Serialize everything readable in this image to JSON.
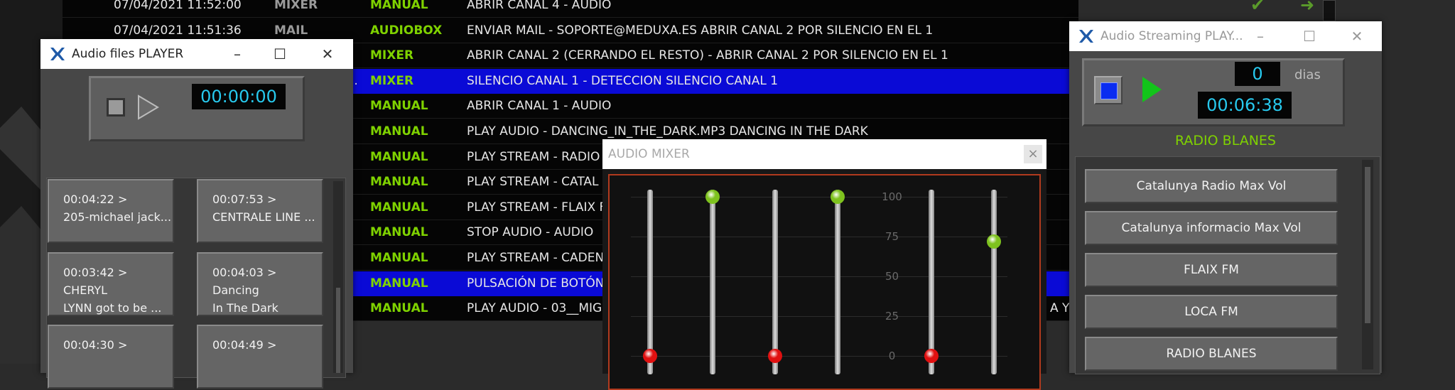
{
  "log": {
    "rows": [
      {
        "date": "07/04/2021 11:52:00",
        "origin": "MIXER",
        "type": "MANUAL",
        "desc": "ABRIR CANAL 4 -   AUDIO",
        "selected": false
      },
      {
        "date": "07/04/2021 11:51:36",
        "origin": "MAIL",
        "type": "AUDIOBOX",
        "desc": "ENVIAR MAIL - SOPORTE@MEDUXA.ES ABRIR CANAL 2 POR SILENCIO EN EL 1",
        "selected": false
      },
      {
        "date": "",
        "origin": "",
        "type": "MIXER",
        "desc": "ABRIR CANAL 2 (CERRANDO EL RESTO) -   ABRIR CANAL 2 POR SILENCIO EN EL 1",
        "selected": false
      },
      {
        "date": "",
        "origin": "",
        "type": "MIXER",
        "desc": "SILENCIO CANAL  1 -   DETECCION SILENCIO CANAL 1",
        "selected": true
      },
      {
        "date": "",
        "origin": "",
        "type": "MANUAL",
        "desc": "ABRIR CANAL 1 -   AUDIO",
        "selected": false
      },
      {
        "date": "",
        "origin": "",
        "type": "MANUAL",
        "desc": "PLAY AUDIO - DANCING_IN_THE_DARK.MP3 DANCING IN THE DARK",
        "selected": false
      },
      {
        "date": "",
        "origin": "",
        "type": "MANUAL",
        "desc": "PLAY STREAM -   RADIO",
        "selected": false
      },
      {
        "date": "",
        "origin": "",
        "type": "MANUAL",
        "desc": "PLAY STREAM -   CATAL",
        "selected": false
      },
      {
        "date": "",
        "origin": "",
        "type": "MANUAL",
        "desc": "PLAY STREAM -   FLAIX F",
        "selected": false
      },
      {
        "date": "",
        "origin": "",
        "type": "MANUAL",
        "desc": "STOP AUDIO -   AUDIO",
        "selected": false
      },
      {
        "date": "",
        "origin": "",
        "type": "MANUAL",
        "desc": "PLAY STREAM -   CADEN",
        "selected": false
      },
      {
        "date": "",
        "origin": "",
        "type": "MANUAL",
        "desc": "PULSACIÓN DE BOTÓN",
        "selected": true
      },
      {
        "date": "",
        "origin": "",
        "type": "MANUAL",
        "desc": "PLAY AUDIO - 03__MIG",
        "selected": false
      }
    ],
    "row3_prefix": "..",
    "row12_suffix": "A Y"
  },
  "player": {
    "title": "Audio files PLAYER",
    "time": "00:00:00",
    "files": [
      {
        "l1": "00:04:22 >",
        "l2": "205-michael jack..."
      },
      {
        "l1": "00:07:53 >",
        "l2": "CENTRALE LINE ..."
      },
      {
        "l1": "00:03:42 > CHERYL",
        "l2": "LYNN got to be ..."
      },
      {
        "l1": "00:04:03 > Dancing",
        "l2": "In The Dark"
      },
      {
        "l1": "00:04:30 >",
        "l2": ""
      },
      {
        "l1": "00:04:49 >",
        "l2": ""
      }
    ]
  },
  "streaming": {
    "title": "Audio Streaming PLAY...",
    "days_value": "0",
    "days_label": "dias",
    "time": "00:06:38",
    "station": "RADIO BLANES",
    "buttons": [
      "Catalunya Radio Max Vol",
      "Catalunya informacio Max Vol",
      "FLAIX FM",
      "LOCA FM",
      "RADIO BLANES"
    ]
  },
  "mixer": {
    "title": "AUDIO MIXER",
    "close": "×",
    "ticks": [
      "100",
      "75",
      "50",
      "25",
      "0"
    ],
    "faders": [
      {
        "level": 0,
        "color": "#e01010"
      },
      {
        "level": 100,
        "color": "#7ec21e"
      },
      {
        "level": 0,
        "color": "#e01010"
      },
      {
        "level": 100,
        "color": "#7ec21e"
      },
      {
        "level": 0,
        "color": "#e01010"
      },
      {
        "level": 72,
        "color": "#7ec21e"
      }
    ]
  },
  "colors": {
    "accent_green": "#7fd200",
    "select_blue": "#0a0ad6",
    "lcd_blue": "#27c9ee",
    "danger_red": "#e01010"
  },
  "window_controls": {
    "minimize": "–",
    "maximize": "☐",
    "close": "✕"
  }
}
